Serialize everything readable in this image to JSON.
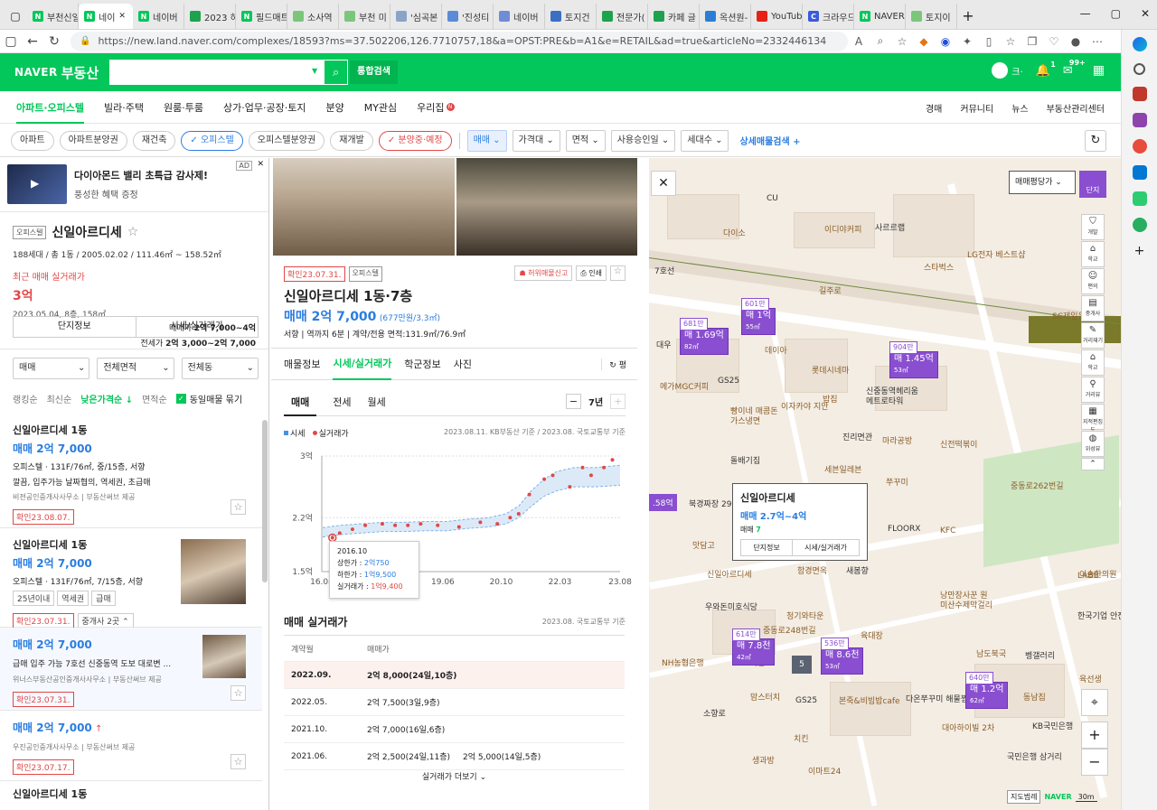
{
  "browser": {
    "tabs": [
      {
        "label": "부천신일",
        "color": "#03c75a",
        "glyph": "N"
      },
      {
        "label": "네이",
        "color": "#03c75a",
        "glyph": "N",
        "active": true
      },
      {
        "label": "네이버 ",
        "color": "#03c75a",
        "glyph": "N"
      },
      {
        "label": "2023 하",
        "color": "#1fa24d",
        "glyph": ""
      },
      {
        "label": "필드매트",
        "color": "#03c75a",
        "glyph": "N"
      },
      {
        "label": "소사역 ",
        "color": "#7bc67b",
        "glyph": ""
      },
      {
        "label": "부천 미",
        "color": "#7bc67b",
        "glyph": ""
      },
      {
        "label": "'심곡본",
        "color": "#8aa4c8",
        "glyph": ""
      },
      {
        "label": "'진성티",
        "color": "#5b8bd4",
        "glyph": ""
      },
      {
        "label": "네이버 ",
        "color": "#6f8cd6",
        "glyph": ""
      },
      {
        "label": "토지건",
        "color": "#3a6fc4",
        "glyph": ""
      },
      {
        "label": "전문가(",
        "color": "#1fa24d",
        "glyph": ""
      },
      {
        "label": "카페 글",
        "color": "#1fa24d",
        "glyph": ""
      },
      {
        "label": "옥션원-",
        "color": "#2c7dd6",
        "glyph": ""
      },
      {
        "label": "YouTub",
        "color": "#e62117",
        "glyph": ""
      },
      {
        "label": "크라우드",
        "color": "#3b5bdb",
        "glyph": "C"
      },
      {
        "label": "NAVER",
        "color": "#03c75a",
        "glyph": "N"
      },
      {
        "label": "토지이",
        "color": "#7bc67b",
        "glyph": ""
      }
    ],
    "url": "https://new.land.naver.com/complexes/18593?ms=37.502206,126.7710757,18&a=OPST:PRE&b=A1&e=RETAIL&ad=true&articleNo=2332446134"
  },
  "header": {
    "logo": "NAVER",
    "logo_sub": "부동산",
    "search_button": "통합검색",
    "user_suffix": "크·",
    "alarm_count": "1",
    "mail_count": "99+"
  },
  "menu": {
    "items": [
      "아파트·오피스텔",
      "빌라·주택",
      "원룸·투룸",
      "상가·업무·공장·토지",
      "분양",
      "MY관심",
      "우리집"
    ],
    "right": [
      "경매",
      "커뮤니티",
      "뉴스",
      "부동산관리센터"
    ]
  },
  "filters": {
    "chips": [
      "아파트",
      "아파트분양권",
      "재건축",
      "오피스텔",
      "오피스텔분양권",
      "재개발",
      "분양중·예정"
    ],
    "selects": [
      "매매",
      "가격대",
      "면적",
      "사용승인일",
      "세대수"
    ],
    "detail": "상세매물검색"
  },
  "ad": {
    "badge": "AD",
    "title": "다이아몬드 밸리 초특급 감사제!",
    "sub": "풍성한 혜택 증정"
  },
  "complex": {
    "type": "오피스텔",
    "name": "신일아르디세",
    "info": "188세대 / 총 1동 / 2005.02.02 / 111.46㎡ ~ 158.52㎡",
    "recent_label": "최근 매매 실거래가",
    "recent_price": "3억",
    "recent_date": "2023.05.04, 8층, 158㎡",
    "sale_label": "매매가",
    "sale_range": "2억 7,000~4억",
    "jeonse_label": "전세가",
    "jeonse_range": "2억 3,000~2억 7,000",
    "btn_info": "단지정보",
    "btn_price": "시세/실거래가"
  },
  "list_filters": {
    "sel1": "매매",
    "sel2": "전체면적",
    "sel3": "전체동",
    "sorts": [
      "랭킹순",
      "최신순",
      "낮은가격순 ↓",
      "면적순"
    ],
    "group": "동일매물 묶기"
  },
  "listings": [
    {
      "title": "신일아르디세 1동",
      "price": "매매 2억 7,000",
      "desc": "오피스텔 · 131F/76㎡, 중/15층, 서향",
      "memo": "깔끔, 입주가능 날짜협의, 역세권, 초급매",
      "agent": "비젼공인중개사사무소 | 부동산써브 제공",
      "confirm": "확인23.08.07."
    },
    {
      "title": "신일아르디세 1동",
      "price": "매매 2억 7,000",
      "desc": "오피스텔 · 131F/76㎡, 7/15층, 서향",
      "tags": [
        "25년이내",
        "역세권",
        "급매"
      ],
      "confirm": "확인23.07.31.",
      "agent_btn": "중개사 2곳"
    },
    {
      "title": "",
      "price": "매매 2억 7,000",
      "desc": "급매 입주 가능 7호선 신중동역 도보 대로변 ...",
      "agent": "위너스부동산공인중개사사무소 | 부동산써브 제공",
      "confirm": "확인23.07.31."
    },
    {
      "title": "",
      "price": "매매 2억 7,000",
      "desc": "",
      "agent": "우진공인중개사사무소 | 부동산써브 제공",
      "confirm": "확인23.07.17."
    },
    {
      "title": "신일아르디세 1동",
      "price": "",
      "desc": "",
      "agent": "",
      "confirm": ""
    }
  ],
  "detail": {
    "confirm_tag": "확인23.07.31.",
    "type_tag": "오피스텔",
    "report": "허위매물신고",
    "print": "인쇄",
    "title": "신일아르디세 1동·7층",
    "price": "매매 2억 7,000",
    "price_unit": "(677만원/3.3㎡)",
    "facts": "서향 | 역까지 6분 | 계약/전용 면적:131.9㎡/76.9㎡",
    "tabs": [
      "매물정보",
      "시세/실거래가",
      "학군정보",
      "사진"
    ],
    "tab_extra": "평",
    "subtabs": [
      "매매",
      "전세",
      "월세"
    ],
    "period": "7년",
    "legend_market": "시세",
    "legend_real": "실거래가",
    "source": "2023.08.11. KB부동산 기준 / 2023.08. 국토교통부 기준",
    "tooltip": {
      "date": "2016.10",
      "upper_label": "상한가 : ",
      "upper": "2억750",
      "lower_label": "하한가 : ",
      "lower": "1억9,500",
      "real_label": "실거래가 : ",
      "real": "1억9,400"
    },
    "trade_title": "매매 실거래가",
    "trade_source": "2023.08. 국토교통부 기준",
    "trade_head": [
      "계약월",
      "매매가"
    ],
    "trades": [
      {
        "month": "2022.09.",
        "price": "2억 8,000(24일,10층)",
        "price2": ""
      },
      {
        "month": "2022.05.",
        "price": "2억 7,500(3일,9층)",
        "price2": ""
      },
      {
        "month": "2021.10.",
        "price": "2억 7,000(16일,6층)",
        "price2": ""
      },
      {
        "month": "2021.06.",
        "price": "2억 2,500(24일,11층)",
        "price2": "2억 5,000(14일,5층)"
      }
    ],
    "more": "실거래가 더보기"
  },
  "chart_data": {
    "type": "line",
    "ylim": [
      1.5,
      3.0
    ],
    "yticks": [
      "3억",
      "2.2억",
      "1.5억"
    ],
    "ytick_values": [
      3.0,
      2.2,
      1.5
    ],
    "xticks": [
      "16.08",
      "19.06",
      "20.10",
      "22.03",
      "23.08"
    ],
    "xtick_values": [
      2016.58,
      2019.42,
      2020.79,
      2022.17,
      2023.58
    ],
    "xlim": [
      2016.58,
      2023.58
    ],
    "series": [
      {
        "name": "시세",
        "kind": "band",
        "x": [
          2016.6,
          2017.0,
          2017.5,
          2018.0,
          2018.5,
          2019.0,
          2019.5,
          2020.0,
          2020.5,
          2020.9,
          2021.2,
          2021.5,
          2021.8,
          2022.1,
          2022.5,
          2023.0,
          2023.58
        ],
        "upper": [
          2.07,
          2.1,
          2.12,
          2.14,
          2.14,
          2.15,
          2.15,
          2.18,
          2.2,
          2.25,
          2.35,
          2.55,
          2.7,
          2.8,
          2.85,
          2.85,
          2.88
        ],
        "lower": [
          1.95,
          1.98,
          2.0,
          2.02,
          2.02,
          2.03,
          2.03,
          2.06,
          2.08,
          2.12,
          2.2,
          2.35,
          2.48,
          2.55,
          2.6,
          2.6,
          2.62
        ]
      },
      {
        "name": "실거래가",
        "kind": "scatter",
        "x": [
          2016.83,
          2017.0,
          2017.3,
          2017.6,
          2018.0,
          2018.3,
          2018.6,
          2018.9,
          2019.3,
          2019.8,
          2020.3,
          2020.7,
          2021.0,
          2021.2,
          2021.45,
          2021.8,
          2022.0,
          2022.4,
          2022.7,
          2022.9,
          2023.2,
          2023.4
        ],
        "y": [
          1.94,
          2.0,
          2.05,
          2.1,
          2.12,
          2.1,
          2.1,
          2.12,
          2.1,
          2.08,
          2.14,
          2.12,
          2.2,
          2.25,
          2.5,
          2.7,
          2.75,
          2.6,
          2.85,
          2.75,
          2.85,
          2.95
        ]
      }
    ]
  },
  "map": {
    "close": "✕",
    "price_type": "매매평당가",
    "complex_btn": "단지",
    "tools": [
      "개발",
      "학교",
      "편의",
      "중개사",
      "거리재기",
      "학교",
      "거리뷰",
      "지적편집도",
      "위성뷰"
    ],
    "popup": {
      "title": "신일아르디세",
      "price": "매매 2.7억~4억",
      "count_label": "매매",
      "count": "7",
      "btn1": "단지정보",
      "btn2": "시세/실거래가"
    },
    "pins": [
      {
        "top": "681만",
        "price": "매 1.69억",
        "area": "82㎡"
      },
      {
        "top": "601만",
        "price": "매 1억",
        "area": "55㎡"
      },
      {
        "top": "904만",
        "price": "매 1.45억",
        "area": "53㎡"
      },
      {
        "top": "614만",
        "price": "매 7.8천",
        "area": "42㎡"
      },
      {
        "top": "536만",
        "price": "매 8.6천",
        "area": "53㎡"
      },
      {
        "top": "640만",
        "price": "매 1.2억",
        "area": "62㎡"
      }
    ],
    "left_pin": ".58억",
    "cluster": "5",
    "labels": [
      "CU",
      "다이소",
      "이디야커피",
      "사르르랩",
      "스타벅스",
      "LG전자 베스트샵",
      "7호선",
      "길주로",
      "SC제일은행",
      "대우",
      "데이아",
      "롯데시네마",
      "GS25",
      "메가MGC커피",
      "밥집",
      "신중동역헤리움 메트로타워",
      "이자카야 지안",
      "빵이네 매콤돈가스냉면",
      "진리면관",
      "마라공방",
      "신전떡볶이",
      "돌배기집",
      "세븐일레븐",
      "쭈꾸미",
      "북경짜장 2900",
      "맛담고",
      "신일아르디세",
      "FLOORX",
      "KFC",
      "함경면옥",
      "새봄향",
      "낭만장사꾼 원미산수제막걸리",
      "이솔한의원",
      "우와돈미호식당",
      "청기와타운",
      "육대장",
      "한국기업 안전교육원",
      "NH농협은행",
      "남도북국",
      "벵갤러리",
      "맘스터치",
      "본죽&비빔밥cafe",
      "다온쭈꾸미 해물찜",
      "대아하이빌 2차",
      "동남집",
      "KB국민은행",
      "생과방",
      "이마트24",
      "국민은행 삼거리",
      "중동로248번길",
      "중동로262번길",
      "소향로",
      "LABB",
      "육선생",
      "GS25",
      "세븐",
      "치킨"
    ],
    "scale_label": "지도범례",
    "scale": "30m"
  }
}
